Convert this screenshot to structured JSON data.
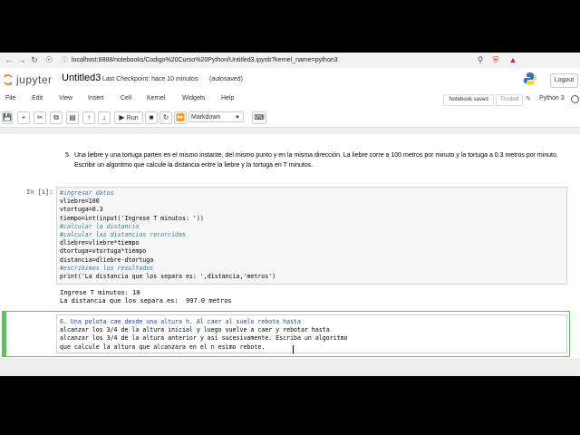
{
  "browser": {
    "url": "localhost:8888/notebooks/Codigo%20Curso%20Python/Untitled3.ipynb?kernel_name=python3"
  },
  "header": {
    "logo_text": "jupyter",
    "notebook_title": "Untitled3",
    "checkpoint": "Last Checkpoint: hace 10 minutos",
    "autosave": "(autosaved)",
    "logout_label": "Logout"
  },
  "menu": {
    "items": [
      "File",
      "Edit",
      "View",
      "Insert",
      "Cell",
      "Kernel",
      "Widgets",
      "Help"
    ],
    "notebook_saved": "Notebook saved",
    "trusted": "Trusted",
    "kernel": "Python 3"
  },
  "toolbar": {
    "run_label": "Run",
    "cell_type": "Markdown"
  },
  "cells": {
    "md5": {
      "number": "5.",
      "text": "Una liebre y una tortuga parten en el mismo instante, del mismo punto y en la misma dirección. La liebre corre a 100 metros por minuto y la tortuga a 0.3 metros por minuto. Escribir un algoritmo que calcule la distancia entre la liebre y la tortuga en T minutos."
    },
    "code1": {
      "prompt": "In [1]:",
      "lines": [
        "#ingresar datos",
        "vliebre=100",
        "vtortuga=0.3",
        "tiempo=int(input('Ingrese T minutos: '))",
        "#calcular la distancia",
        "#calcular las distancias recorridas",
        "dliebre=vliebre*tiempo",
        "dtortuga=vtortuga*tiempo",
        "distancia=dliebre-dtortuga",
        "#escribimos los resultados",
        "print('La distancia que los separa es: ',distancia,'metros')"
      ],
      "output": [
        "Ingrese T minutos: 10",
        "La distancia que los separa es:  997.0 metros"
      ]
    },
    "edit6": {
      "lines": [
        "6. Una pelota cae desde una altura h. Al caer al suelo rebota hasta",
        "alcanzar los 3/4 de la altura inicial y luego vuelve a caer y rebotar hasta",
        "alcanzar los 3/4 de la altura anterior y así sucesivamente. Escriba un algoritmo",
        "que calcule la altura que alcanzara en el n esimo rebote."
      ]
    }
  }
}
